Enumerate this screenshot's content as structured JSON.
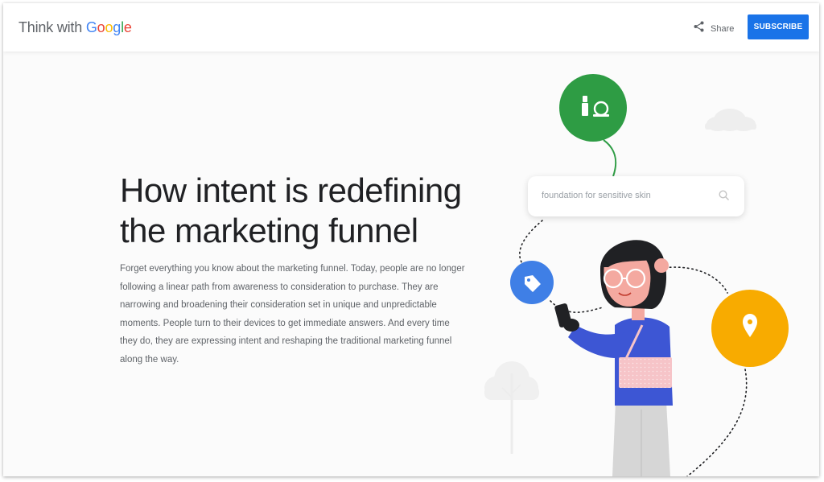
{
  "header": {
    "logo_prefix": "Think with ",
    "logo_letters": [
      {
        "ch": "G",
        "color": "#4285F4"
      },
      {
        "ch": "o",
        "color": "#EA4335"
      },
      {
        "ch": "o",
        "color": "#FBBC05"
      },
      {
        "ch": "g",
        "color": "#4285F4"
      },
      {
        "ch": "l",
        "color": "#34A853"
      },
      {
        "ch": "e",
        "color": "#EA4335"
      }
    ],
    "share_label": "Share",
    "subscribe_label": "SUBSCRIBE"
  },
  "hero": {
    "title": "How intent is redefining the marketing funnel",
    "description": "Forget everything you know about the marketing funnel. Today, people are no longer following a linear path from awareness to consideration to purchase. They are narrowing and broadening their consideration set in unique and unpredictable moments. People turn to their devices to get immediate answers. And every time they do, they are expressing intent and reshaping the traditional marketing funnel along the way."
  },
  "illustration": {
    "search_query": "foundation for sensitive skin",
    "icons": [
      "makeup-icon",
      "price-tag-icon",
      "location-pin-icon"
    ],
    "colors": {
      "green": "#2e9c44",
      "blue": "#3f7fe6",
      "yellow": "#f8ab00",
      "sweater": "#3d56d4",
      "bag": "#f6c4c8"
    }
  },
  "colors": {
    "accent": "#1a73e8",
    "text_primary": "#202124",
    "text_secondary": "#5f6368"
  }
}
